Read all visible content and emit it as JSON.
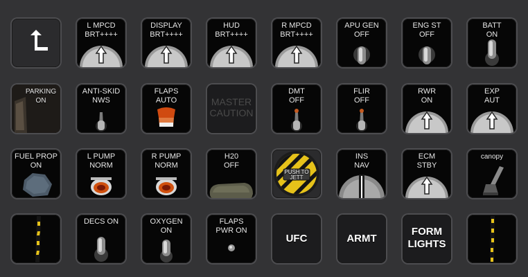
{
  "colors": {
    "background": "#333335",
    "button_face": "#060606",
    "button_border": "#4d4d50",
    "label_text": "#e8e8e8",
    "warning_amber": "#e05a10",
    "hazard_yellow": "#e6c21a"
  },
  "panel": {
    "row1": [
      {
        "id": "back",
        "label": "",
        "icon": "back-arrow-icon"
      },
      {
        "id": "l-mpcd",
        "label": "L MPCD\nBRT++++",
        "icon": "dial-knob-icon"
      },
      {
        "id": "display",
        "label": "DISPLAY\nBRT++++",
        "icon": "dial-knob-icon"
      },
      {
        "id": "hud",
        "label": "HUD\nBRT++++",
        "icon": "dial-knob-icon"
      },
      {
        "id": "r-mpcd",
        "label": "R MPCD\nBRT++++",
        "icon": "dial-knob-icon"
      },
      {
        "id": "apu-gen",
        "label": "APU GEN\nOFF",
        "icon": "toggle-switch-icon"
      },
      {
        "id": "eng-st",
        "label": "ENG ST\nOFF",
        "icon": "toggle-switch-icon"
      },
      {
        "id": "batt",
        "label": "BATT\nON",
        "icon": "toggle-switch-icon"
      }
    ],
    "row2": [
      {
        "id": "parking",
        "label": "PARKING\nON",
        "icon": "parking-brake-handle-icon"
      },
      {
        "id": "anti-skid",
        "label": "ANTI-SKID\nNWS",
        "icon": "bat-toggle-icon"
      },
      {
        "id": "flaps",
        "label": "FLAPS\nAUTO",
        "icon": "flaps-lever-icon"
      },
      {
        "id": "master-caution",
        "label": "MASTER\nCAUTION",
        "icon": "caution-light-icon"
      },
      {
        "id": "dmt",
        "label": "DMT\nOFF",
        "icon": "bat-toggle-icon"
      },
      {
        "id": "flir",
        "label": "FLIR\nOFF",
        "icon": "bat-toggle-icon"
      },
      {
        "id": "rwr",
        "label": "RWR\nON",
        "icon": "dial-knob-icon"
      },
      {
        "id": "exp",
        "label": "EXP\nAUT",
        "icon": "dial-knob-icon"
      }
    ],
    "row3": [
      {
        "id": "fuel-prop",
        "label": "FUEL PROP\nON",
        "icon": "hex-knob-icon"
      },
      {
        "id": "l-pump",
        "label": "L PUMP\nNORM",
        "icon": "amber-light-icon"
      },
      {
        "id": "r-pump",
        "label": "R PUMP\nNORM",
        "icon": "amber-light-icon"
      },
      {
        "id": "h20",
        "label": "H20\nOFF",
        "icon": "paddle-switch-icon"
      },
      {
        "id": "push-to-jett",
        "label": "PUSH TO\nJETT",
        "icon": "jettison-button-icon"
      },
      {
        "id": "ins",
        "label": "INS\nNAV",
        "icon": "rotary-selector-icon"
      },
      {
        "id": "ecm",
        "label": "ECM\nSTBY",
        "icon": "dial-knob-icon"
      },
      {
        "id": "canopy",
        "label": "canopy",
        "icon": "canopy-handle-icon"
      }
    ],
    "row4": [
      {
        "id": "stick-left",
        "label": "",
        "icon": "striped-handle-icon"
      },
      {
        "id": "decs",
        "label": "DECS ON",
        "icon": "toggle-switch-icon"
      },
      {
        "id": "oxygen",
        "label": "OXYGEN\nON",
        "icon": "toggle-switch-icon"
      },
      {
        "id": "flaps-pwr",
        "label": "FLAPS\nPWR ON",
        "icon": "button-dot-icon"
      },
      {
        "id": "ufc",
        "label": "UFC",
        "icon": ""
      },
      {
        "id": "armt",
        "label": "ARMT",
        "icon": ""
      },
      {
        "id": "form-lights",
        "label": "FORM\nLIGHTS",
        "icon": ""
      },
      {
        "id": "stick-right",
        "label": "",
        "icon": "striped-handle-icon"
      }
    ]
  }
}
